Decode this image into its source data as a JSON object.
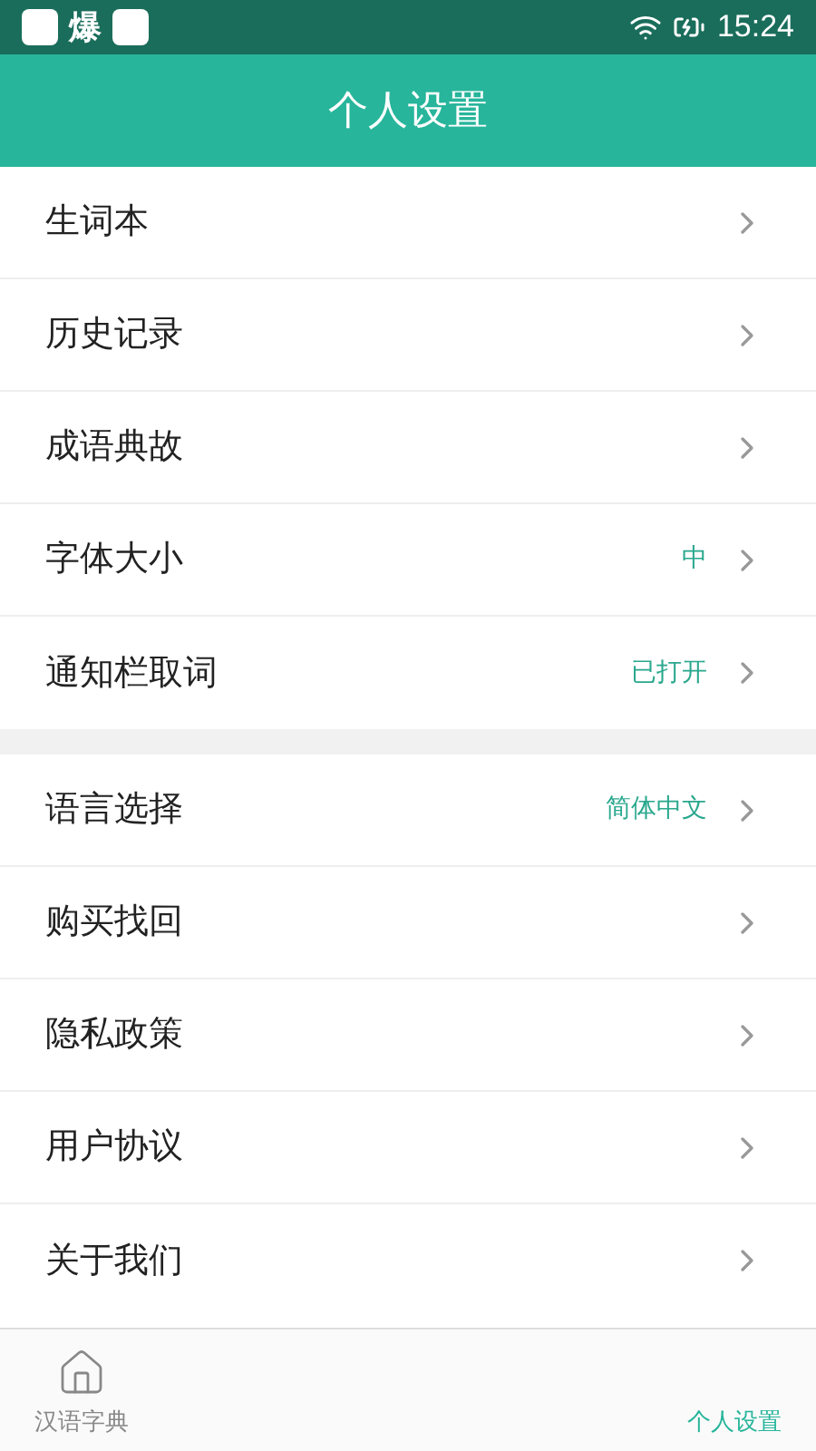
{
  "status_bar": {
    "time": "15:24",
    "app_glyph": "爆"
  },
  "header": {
    "title": "个人设置"
  },
  "groups": [
    {
      "items": [
        {
          "label": "生词本"
        },
        {
          "label": "历史记录"
        },
        {
          "label": "成语典故"
        },
        {
          "label": "字体大小",
          "value": "中"
        },
        {
          "label": "通知栏取词",
          "value": "已打开"
        }
      ]
    },
    {
      "items": [
        {
          "label": "语言选择",
          "value": "简体中文"
        },
        {
          "label": "购买找回"
        },
        {
          "label": "隐私政策"
        },
        {
          "label": "用户协议"
        },
        {
          "label": "关于我们"
        }
      ]
    }
  ],
  "tab_bar": [
    {
      "label": "汉语字典",
      "selected": false,
      "kind": "home"
    },
    {
      "label": "个人设置",
      "selected": true,
      "kind": "blank"
    }
  ]
}
